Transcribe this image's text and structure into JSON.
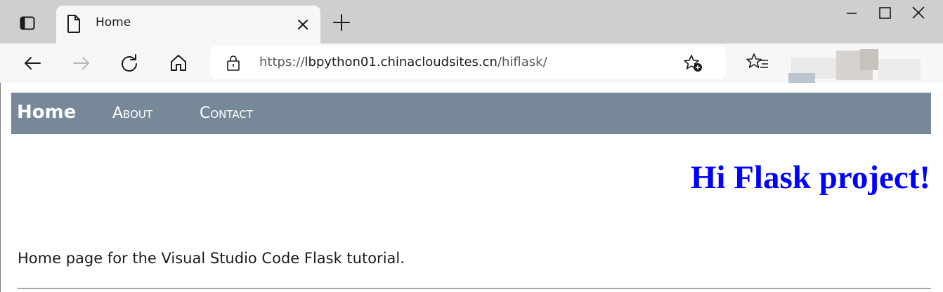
{
  "browser": {
    "tab": {
      "title": "Home"
    },
    "address_bar": {
      "url_prefix": "https://",
      "url_host": "lbpython01.chinacloudsites.cn",
      "url_path": "/hiflask/"
    },
    "icons": {
      "tab_actions": "tab-actions-icon",
      "page": "page-icon",
      "close": "close-icon",
      "new_tab": "plus-icon",
      "minimize": "minimize-icon",
      "maximize": "maximize-icon",
      "window_close": "close-icon",
      "back": "back-arrow-icon",
      "forward": "forward-arrow-icon",
      "refresh": "refresh-icon",
      "home": "home-icon",
      "lock": "lock-icon",
      "add_favorite": "star-plus-icon",
      "favorites": "favorites-icon"
    }
  },
  "page": {
    "navbar": {
      "home": "Home",
      "about": "About",
      "contact": "Contact",
      "background": "#778899"
    },
    "heading": "Hi Flask project!",
    "heading_color": "#0000ff",
    "body_text": "Home page for the Visual Studio Code Flask tutorial."
  }
}
